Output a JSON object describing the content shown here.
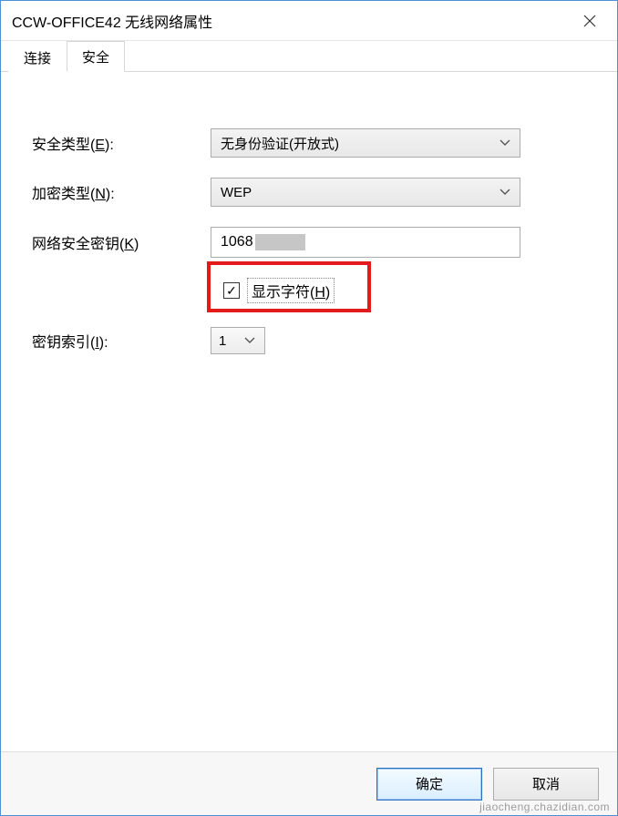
{
  "window": {
    "title": "CCW-OFFICE42 无线网络属性"
  },
  "tabs": {
    "connection": "连接",
    "security": "安全"
  },
  "labels": {
    "security_type": "安全类型(E):",
    "encryption_type": "加密类型(N):",
    "network_key": "网络安全密钥(K)",
    "key_index": "密钥索引(I):",
    "show_chars": "显示字符(H)"
  },
  "fields": {
    "security_type_value": "无身份验证(开放式)",
    "encryption_type_value": "WEP",
    "network_key_visible": "1068",
    "key_index_value": "1",
    "show_chars_checked": "✓"
  },
  "footer": {
    "ok": "确定",
    "cancel": "取消"
  },
  "watermark": "jiaocheng.chazidian.com"
}
